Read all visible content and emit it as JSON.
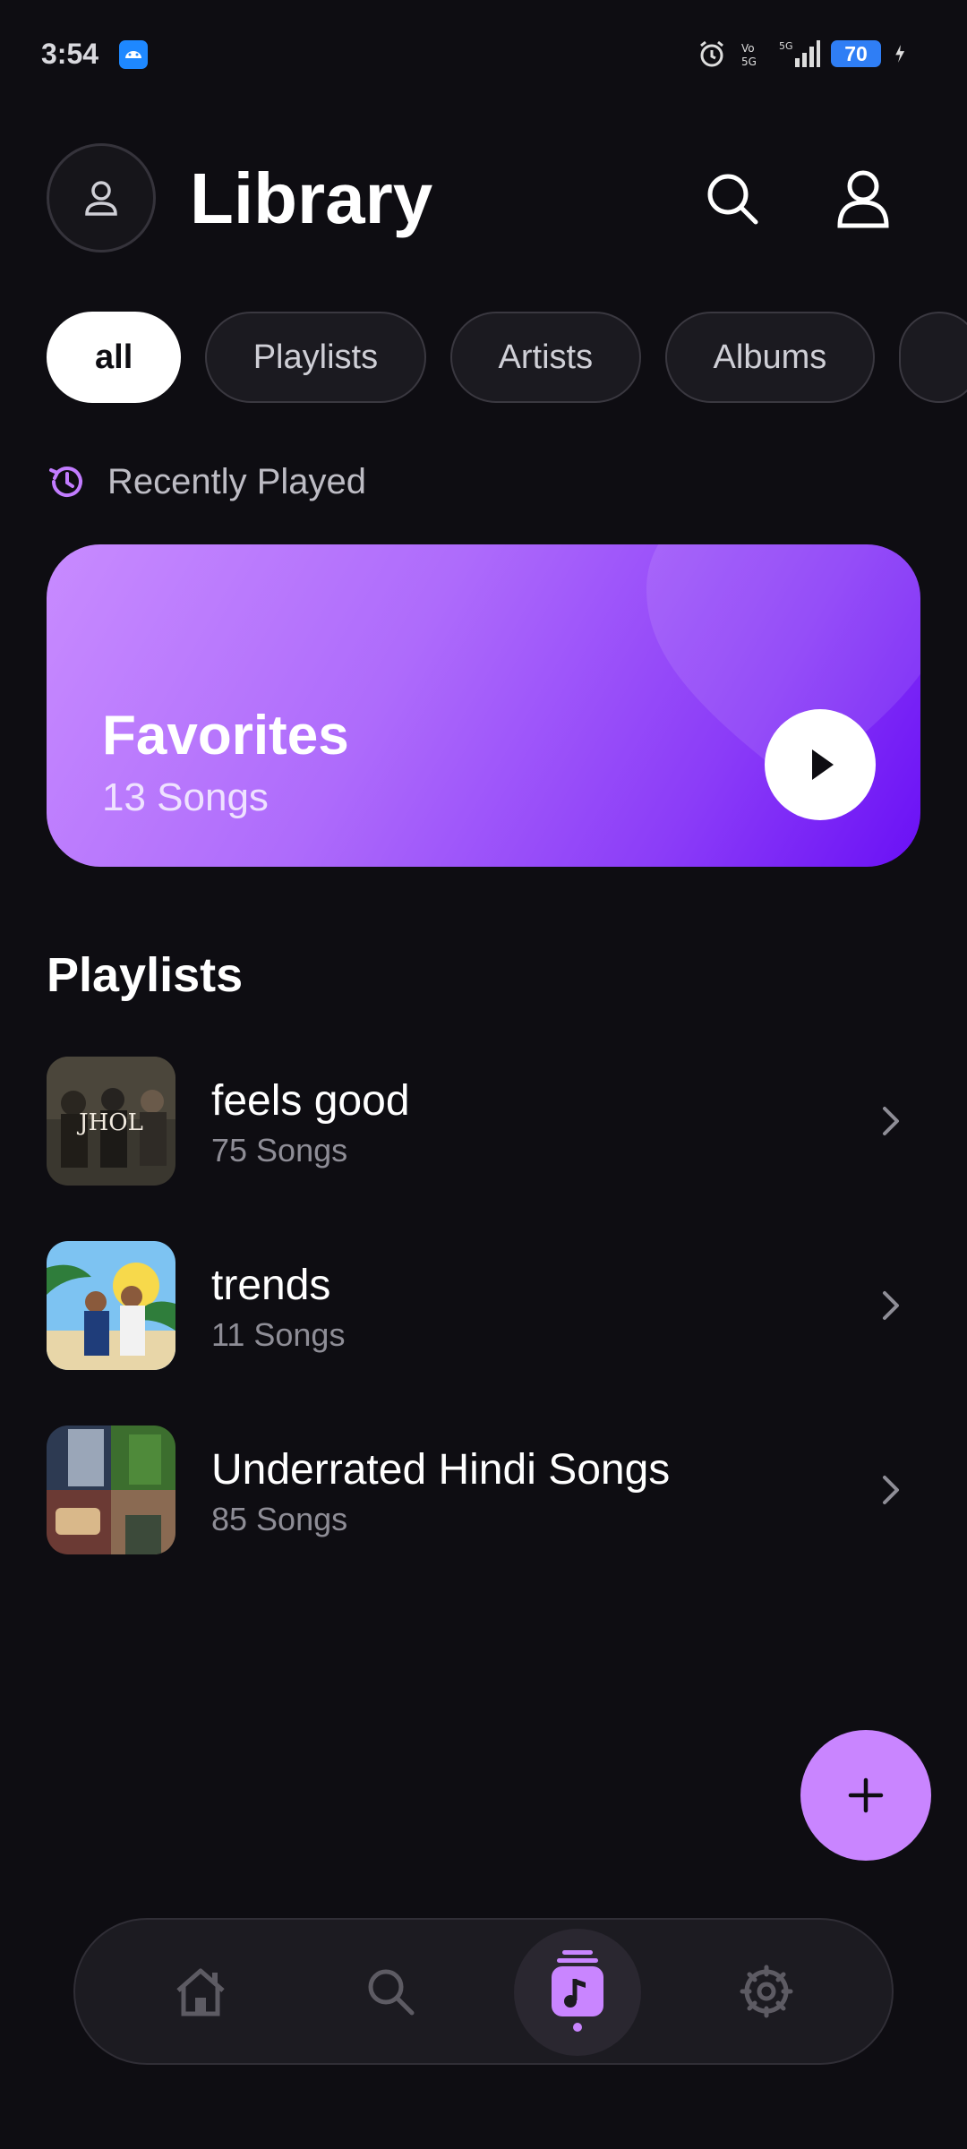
{
  "status_bar": {
    "time": "3:54",
    "battery": "70",
    "icons": [
      "android-icon",
      "alarm-icon",
      "volte-icon",
      "5g-icon",
      "signal-icon",
      "charging-icon"
    ]
  },
  "header": {
    "title": "Library",
    "icons": [
      "avatar-icon",
      "search-icon",
      "profile-icon"
    ]
  },
  "filters": {
    "chips": [
      "all",
      "Playlists",
      "Artists",
      "Albums"
    ],
    "selected": "all"
  },
  "recent": {
    "label": "Recently Played",
    "icon": "history-icon"
  },
  "favorites": {
    "title": "Favorites",
    "subtitle": "13 Songs",
    "icon": "play-icon"
  },
  "playlists": {
    "title": "Playlists",
    "items": [
      {
        "name": "feels good",
        "count": "75 Songs"
      },
      {
        "name": "trends",
        "count": "11 Songs"
      },
      {
        "name": "Underrated Hindi Songs",
        "count": "85 Songs"
      }
    ]
  },
  "fab": {
    "icon": "plus-icon"
  },
  "nav": {
    "items": [
      "home-icon",
      "search-icon",
      "library-icon",
      "settings-icon"
    ],
    "active": "library-icon"
  },
  "colors": {
    "background": "#0e0d12",
    "accent": "#c985ff",
    "card_gradient_start": "#c88bff",
    "card_gradient_end": "#6a10f5"
  }
}
